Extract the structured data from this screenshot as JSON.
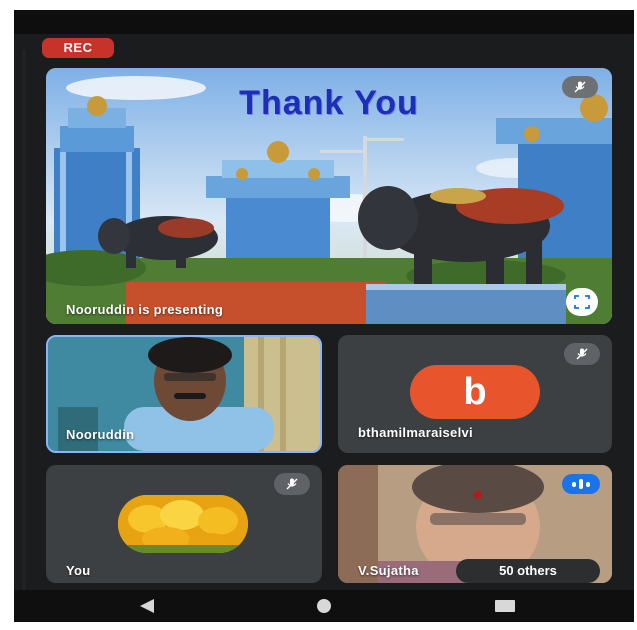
{
  "rec_badge": "REC",
  "presentation": {
    "slide_title": "Thank You",
    "presenter_label": "Nooruddin is presenting"
  },
  "participants": [
    {
      "name": "Nooruddin",
      "muted": false,
      "active_speaker_outline": true
    },
    {
      "name": "bthamilmaraiselvi",
      "avatar_letter": "b",
      "avatar_color": "#e8542b",
      "muted": true
    },
    {
      "name": "You",
      "muted": true
    },
    {
      "name": "V.Sujatha",
      "speaking": true
    }
  ],
  "others_chip": "50 others",
  "colors": {
    "accent": "#1a73e8",
    "rec": "#c7332a",
    "tile_bg": "#3c4043"
  },
  "nav": [
    "back-icon",
    "home-icon",
    "recents-icon"
  ]
}
